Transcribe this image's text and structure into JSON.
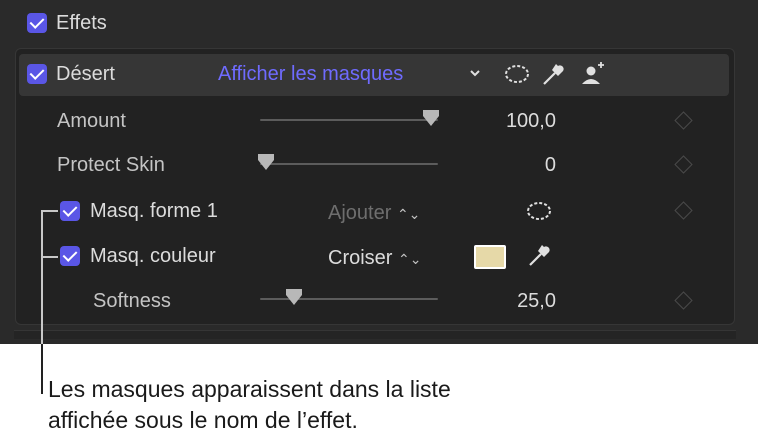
{
  "colors": {
    "accent": "#5a56e6",
    "link": "#6f6bff",
    "panel": "#2a2a2a",
    "swatch": "#e6d9a8"
  },
  "effects": {
    "label": "Effets",
    "checked": true
  },
  "desert": {
    "label": "Désert",
    "checked": true,
    "show_masks": "Afficher les masques",
    "icons": [
      "chevron-down-icon",
      "mask-ellipse-icon",
      "eyedropper-icon",
      "person-add-icon"
    ]
  },
  "params": [
    {
      "label": "Amount",
      "value": "100,0",
      "slider_fraction": 1.0
    },
    {
      "label": "Protect Skin",
      "value": "0",
      "slider_fraction": 0.0
    }
  ],
  "masks": [
    {
      "label": "Masq. forme 1",
      "checked": true,
      "mode": "Ajouter",
      "mode_enabled": false,
      "icon": "mask-ellipse-icon"
    },
    {
      "label": "Masq. couleur",
      "checked": true,
      "mode": "Croiser",
      "mode_enabled": true,
      "icon": "eyedropper-icon",
      "swatch": "#e6d9a8"
    }
  ],
  "softness": {
    "label": "Softness",
    "value": "25,0",
    "slider_fraction": 0.2
  },
  "callout": {
    "line1": "Les masques apparaissent dans la liste",
    "line2": "affichée sous le nom de l’effet."
  }
}
